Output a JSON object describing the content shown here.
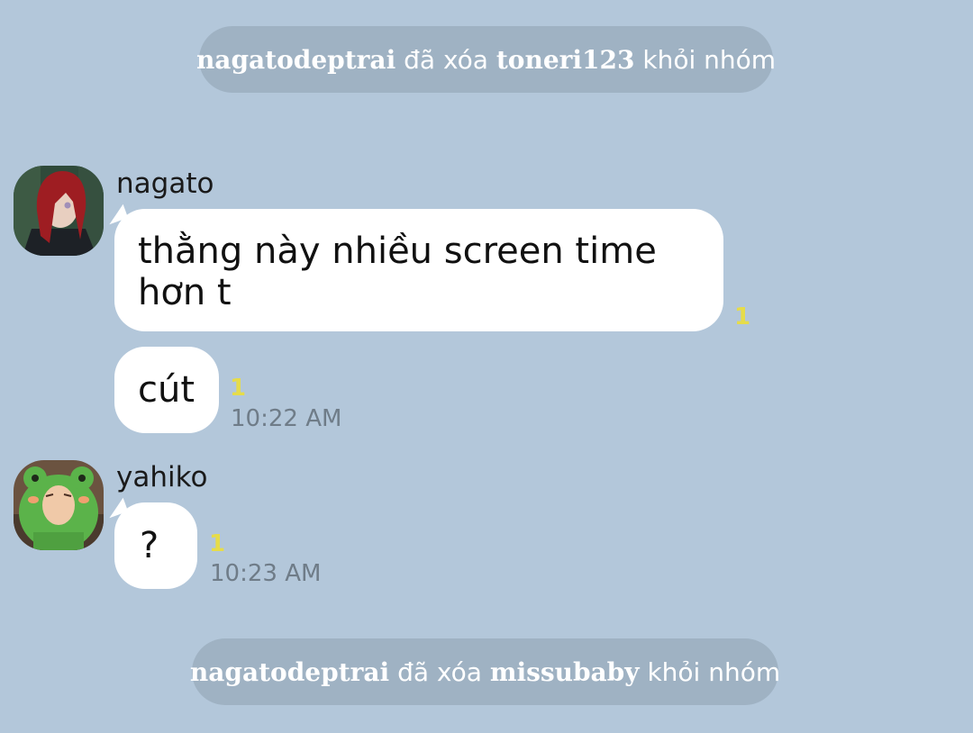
{
  "system_messages": [
    {
      "actor": "nagatodeptrai",
      "verb": "đã xóa",
      "target": "toneri123",
      "suffix": "khỏi nhóm"
    },
    {
      "actor": "nagatodeptrai",
      "verb": "đã xóa",
      "target": "missubaby",
      "suffix": "khỏi nhóm"
    }
  ],
  "messages": [
    {
      "sender": "nagato",
      "avatar": "red-haired-character-avatar",
      "bubbles": [
        {
          "text": "thằng này nhiều screen time hơn t",
          "unread": "1",
          "time": ""
        },
        {
          "text": "cút",
          "unread": "1",
          "time": "10:22 AM"
        }
      ]
    },
    {
      "sender": "yahiko",
      "avatar": "frog-hood-character-avatar",
      "bubbles": [
        {
          "text": "?",
          "unread": "1",
          "time": "10:23 AM"
        }
      ]
    }
  ],
  "colors": {
    "background": "#b3c7da",
    "system_pill": "#9fb2c3",
    "bubble": "#ffffff",
    "unread": "#e6dc4a",
    "timestamp": "#6f7c88"
  }
}
